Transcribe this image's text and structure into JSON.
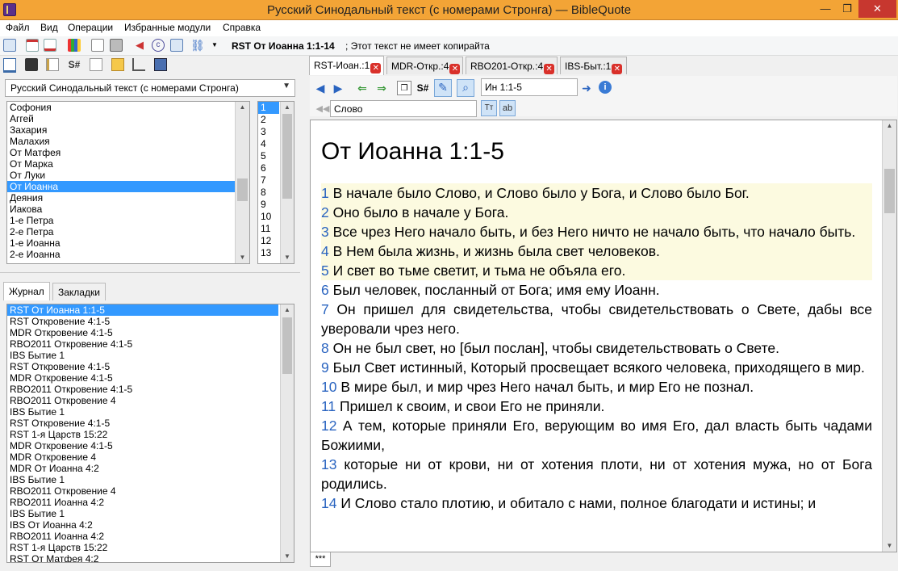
{
  "window": {
    "title": "Русский Синодальный текст (с номерами Стронга) — BibleQuote",
    "min_glyph": "—",
    "max_glyph": "❐",
    "close_glyph": "✕"
  },
  "menu": [
    "Файл",
    "Вид",
    "Операции",
    "Избранные модули",
    "Справка"
  ],
  "toolbar": {
    "reference": "RST От Иоанна 1:1-14",
    "copyright_note": "; Этот текст не имеет копирайта"
  },
  "left_panel": {
    "module": "Русский Синодальный текст (с номерами Стронга)",
    "books": [
      "Софония",
      "Аггей",
      "Захария",
      "Малахия",
      "От Матфея",
      "От Марка",
      "От Луки",
      "От Иоанна",
      "Деяния",
      "Иакова",
      "1-е Петра",
      "2-е Петра",
      "1-е Иоанна",
      "2-е Иоанна"
    ],
    "selected_book_index": 7,
    "chapters": [
      "1",
      "2",
      "3",
      "4",
      "5",
      "6",
      "7",
      "8",
      "9",
      "10",
      "11",
      "12",
      "13"
    ],
    "selected_chapter_index": 0,
    "tabs": [
      "Журнал",
      "Закладки"
    ],
    "history": [
      "RST От Иоанна 1:1-5",
      "RST Откровение 4:1-5",
      "MDR Откровение 4:1-5",
      "RBO2011 Откровение 4:1-5",
      "IBS Бытие 1",
      "RST Откровение 4:1-5",
      "MDR Откровение 4:1-5",
      "RBO2011 Откровение 4:1-5",
      "RBO2011 Откровение 4",
      "IBS Бытие 1",
      "RST Откровение 4:1-5",
      "RST 1-я Царств 15:22",
      "MDR Откровение 4:1-5",
      "MDR Откровение 4",
      "MDR От Иоанна 4:2",
      "IBS Бытие 1",
      "RBO2011 Откровение 4",
      "RBO2011 Иоанна 4:2",
      "IBS Бытие 1",
      "IBS От Иоанна 4:2",
      "RBO2011 Иоанна 4:2",
      "RST 1-я Царств 15:22",
      "RST От Матфея 4:2"
    ]
  },
  "doc_tabs": [
    "RST-Иоан.:1",
    "MDR-Откр.:4",
    "RBO201-Откр.:4",
    "IBS-Быт.:1"
  ],
  "nav": {
    "reference_input": "Ин 1:1-5",
    "search_input": "Слово"
  },
  "passage": {
    "title": "От Иоанна 1:1-5",
    "verses": [
      {
        "n": "1",
        "text": "В начале было Слово, и Слово было у Бога, и Слово было Бог."
      },
      {
        "n": "2",
        "text": "Оно было в начале у Бога."
      },
      {
        "n": "3",
        "text": "Все чрез Него начало быть, и без Него ничто не начало быть, что начало быть."
      },
      {
        "n": "4",
        "text": "В Нем была жизнь, и жизнь была свет человеков."
      },
      {
        "n": "5",
        "text": "И свет во тьме светит, и тьма не объяла его."
      },
      {
        "n": "6",
        "text": "Был человек, посланный от Бога; имя ему Иоанн."
      },
      {
        "n": "7",
        "text": "Он пришел для свидетельства, чтобы свидетельствовать о Свете, дабы все уверовали чрез него."
      },
      {
        "n": "8",
        "text": "Он не был свет, но [был послан], чтобы свидетельствовать о Свете."
      },
      {
        "n": "9",
        "text": "Был Свет истинный, Который просвещает всякого человека, приходящего в мир."
      },
      {
        "n": "10",
        "text": "В мире был, и мир чрез Него начал быть, и мир Его не познал."
      },
      {
        "n": "11",
        "text": "Пришел к своим, и свои Его не приняли."
      },
      {
        "n": "12",
        "text": "А тем, которые приняли Его, верующим во имя Его, дал власть быть чадами Божиими,"
      },
      {
        "n": "13",
        "text": "которые ни от крови, ни от хотения плоти, ни от хотения мужа, но от Бога родились."
      },
      {
        "n": "14",
        "text": "И Слово стало плотию, и обитало с нами, полное благодати и истины; и"
      }
    ],
    "highlighted_count": 5
  },
  "bottom_tab": "***",
  "colors": {
    "titlebar": "#f3a436",
    "selection": "#3399ff",
    "verse_number": "#2a64c0",
    "highlight": "#fcfae0",
    "close_button": "#c7372f"
  }
}
